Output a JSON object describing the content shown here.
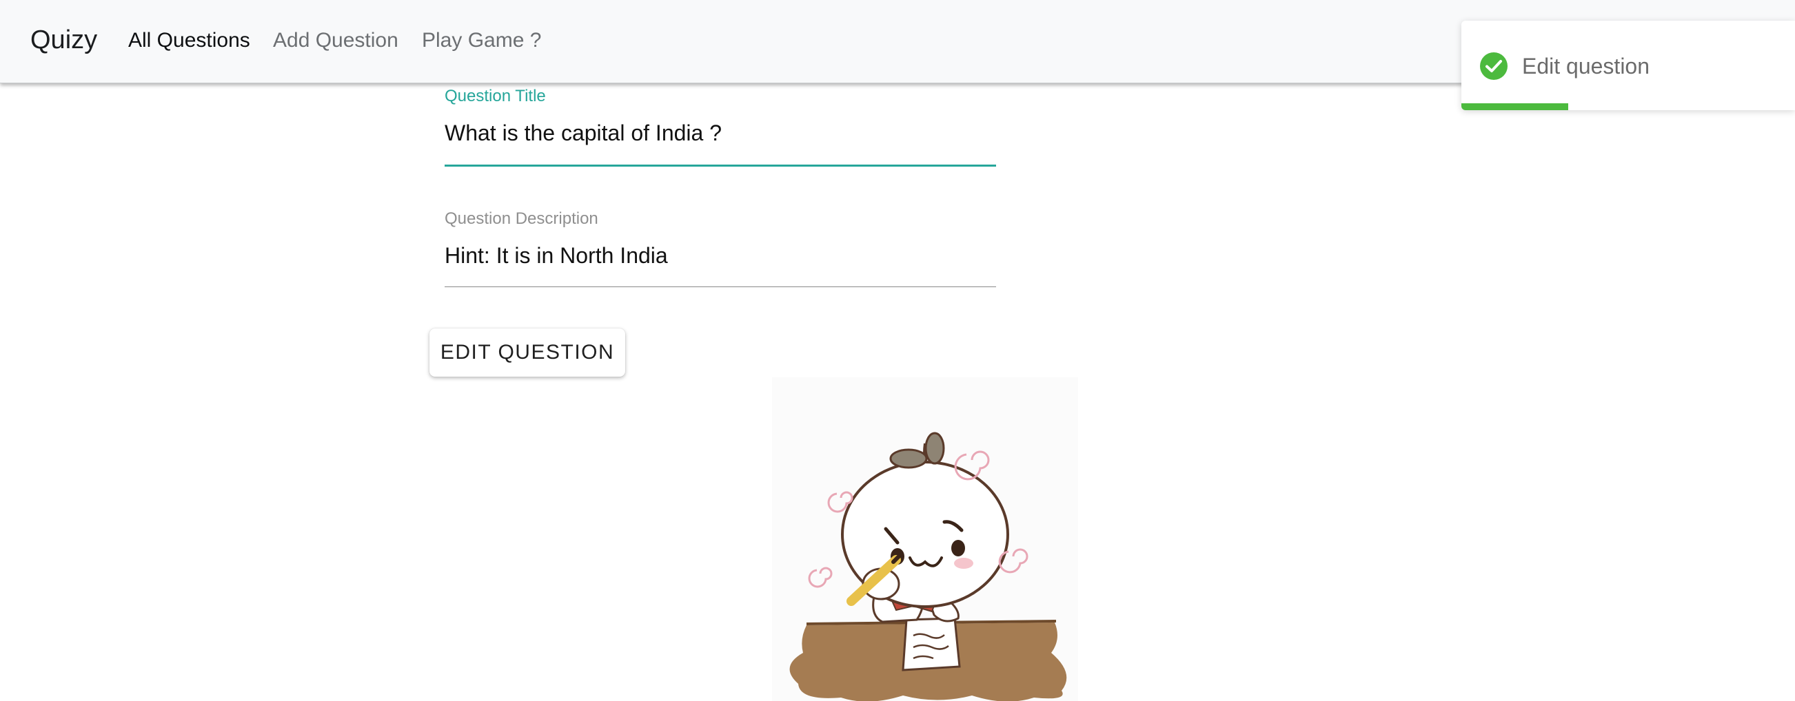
{
  "navbar": {
    "brand": "Quizy",
    "links": [
      {
        "label": "All Questions",
        "active": true
      },
      {
        "label": "Add Question",
        "active": false
      },
      {
        "label": "Play Game ?",
        "active": false
      }
    ]
  },
  "form": {
    "title_label": "Question Title",
    "title_value": "What is the capital of India ?",
    "description_label": "Question Description",
    "description_value": "Hint: It is in North India",
    "submit_label": "EDIT QUESTION"
  },
  "toast": {
    "message": "Edit question",
    "progress": 0.32,
    "color": "#4cba3e"
  },
  "colors": {
    "accent": "#26a69a",
    "navbar_bg": "#f8f9fa",
    "success": "#4cba3e"
  },
  "icons": {
    "toast_icon": "check-circle-icon"
  }
}
